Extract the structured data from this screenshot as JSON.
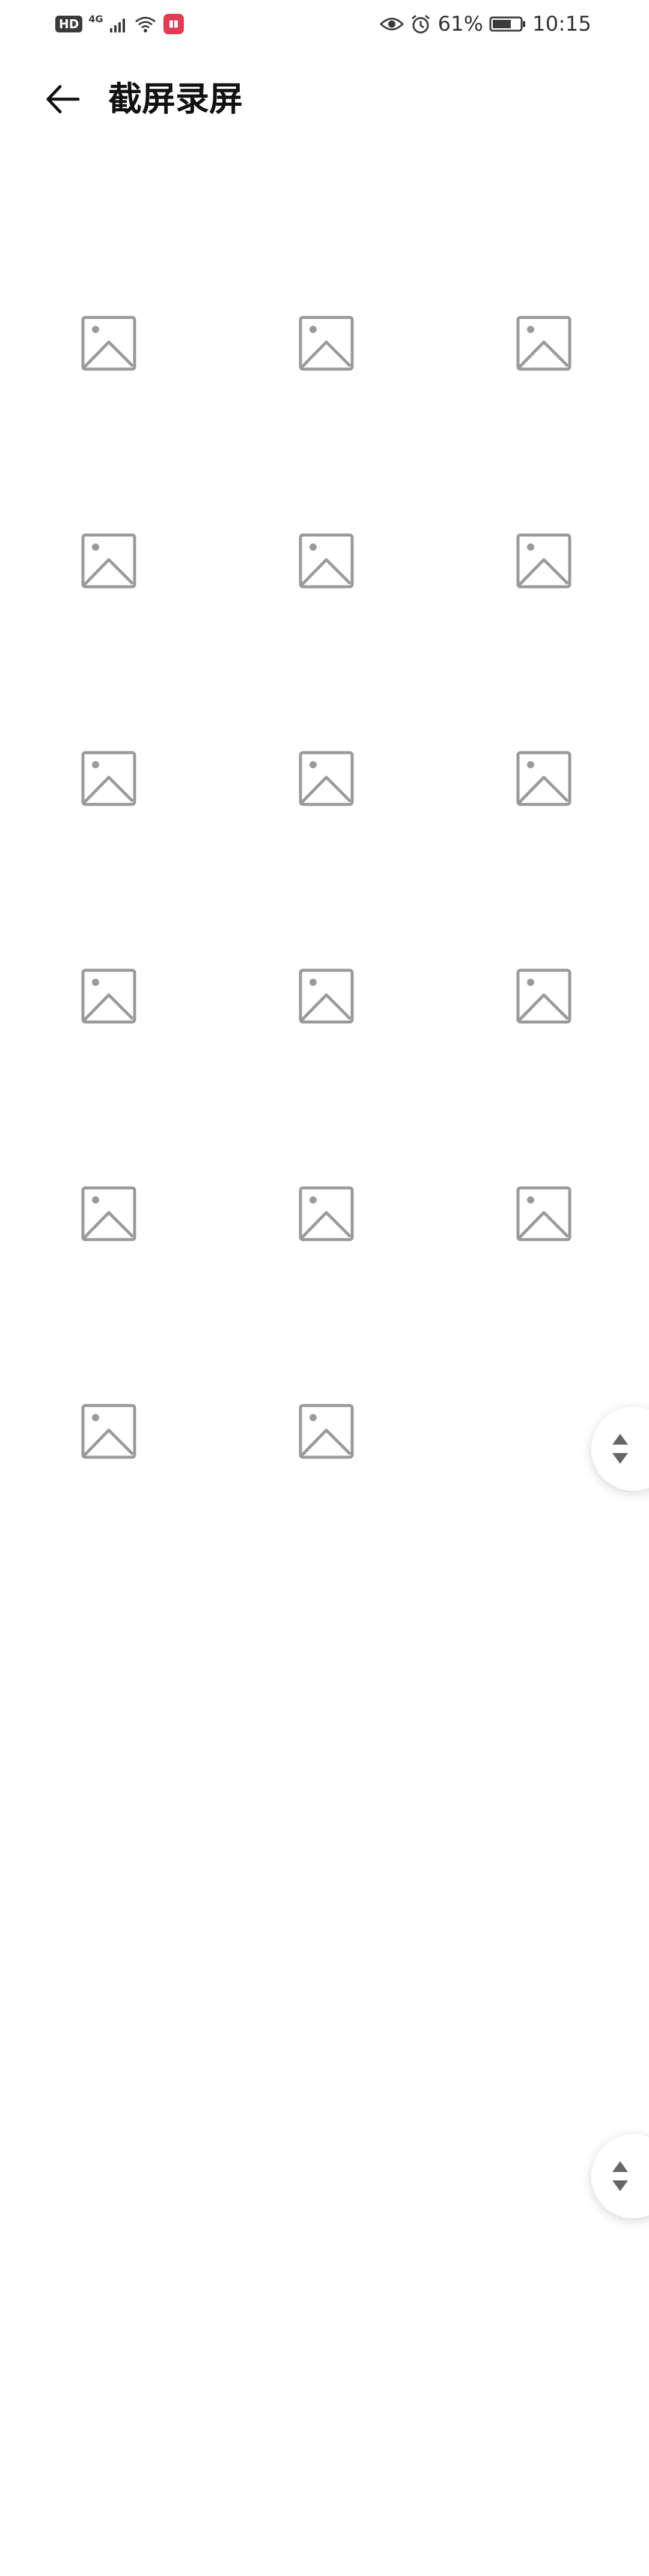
{
  "status_bar": {
    "hd_label": "HD",
    "network_label": "4G",
    "battery_percent": "61%",
    "time": "10:15",
    "icons": [
      "hd-icon",
      "signal-icon",
      "wifi-icon",
      "app-notification-icon",
      "eye-icon",
      "alarm-icon",
      "battery-icon"
    ]
  },
  "header": {
    "title": "截屏录屏",
    "back_icon": "arrow-left-icon"
  },
  "gallery": {
    "item_count": 17,
    "placeholder_icon": "image-placeholder-icon",
    "icon_color": "#9a9a9a"
  },
  "scroll_handles": {
    "icon": "scroll-up-down-icon",
    "count": 2
  }
}
